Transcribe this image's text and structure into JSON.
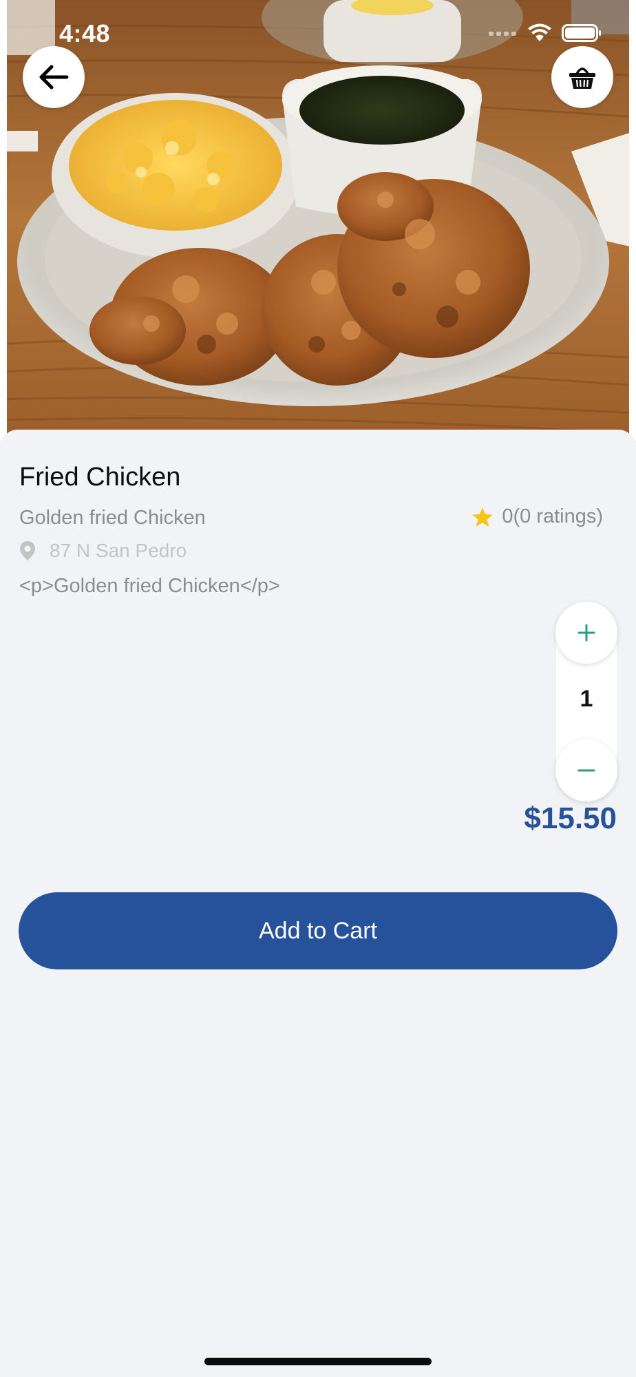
{
  "status_bar": {
    "time": "4:48"
  },
  "header": {
    "back_icon": "arrow-left-icon",
    "cart_icon": "basket-icon"
  },
  "item": {
    "title": "Fried Chicken",
    "subtitle": "Golden fried Chicken",
    "rating_text": "0(0 ratings)",
    "rating_icon": "star-icon",
    "location": "87 N San Pedro",
    "location_icon": "map-pin-icon",
    "description": "<p>Golden fried Chicken</p>",
    "price": "$15.50"
  },
  "quantity": {
    "value": "1"
  },
  "actions": {
    "add_to_cart": "Add to Cart"
  },
  "colors": {
    "accent": "#26529c",
    "stepper_icon": "#2a9d7a",
    "star": "#f5c518",
    "background": "#f2f3f7"
  }
}
